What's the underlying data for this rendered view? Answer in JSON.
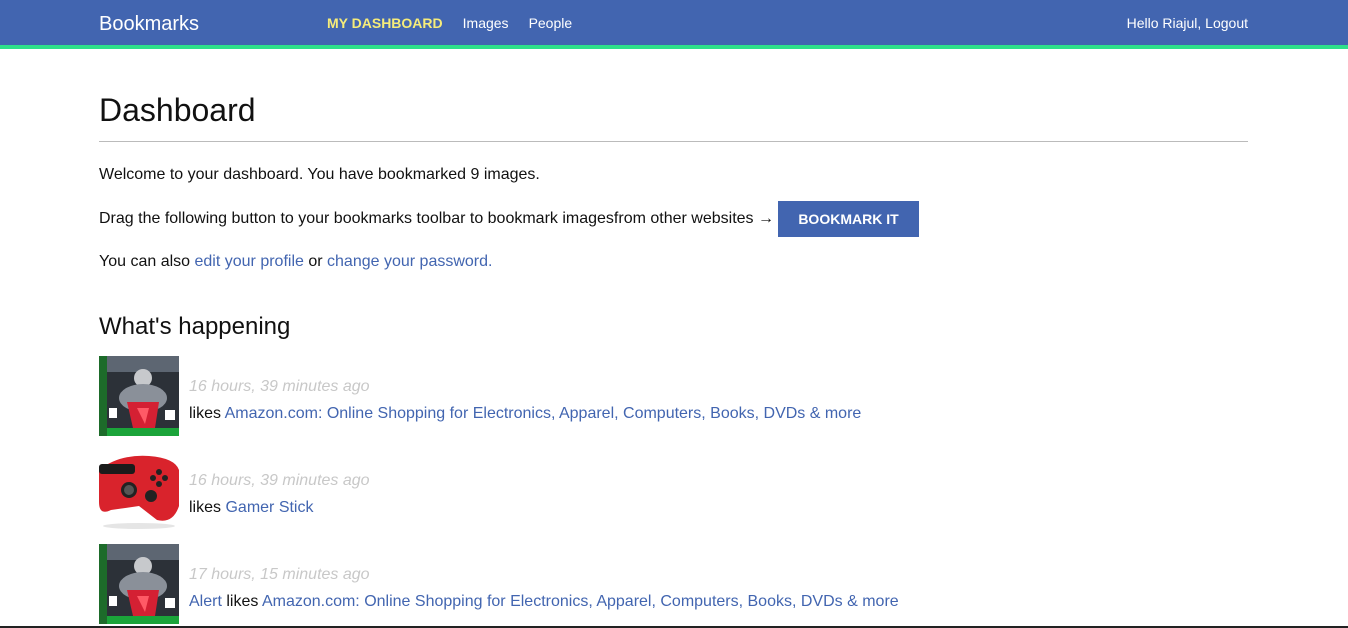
{
  "nav": {
    "logo": "Bookmarks",
    "items": [
      {
        "label": "MY DASHBOARD",
        "active": true
      },
      {
        "label": "Images",
        "active": false
      },
      {
        "label": "People",
        "active": false
      }
    ],
    "greeting": "Hello Riajul,",
    "logout_label": "Logout"
  },
  "main": {
    "title": "Dashboard",
    "welcome_text": "Welcome to your dashboard. You have bookmarked 9 images.",
    "drag_text": "Drag the following button to your bookmarks toolbar to bookmark imagesfrom other websites →",
    "bookmark_button_label": "BOOKMARK IT",
    "also_prefix": "You can also",
    "edit_profile_label": "edit your profile",
    "also_or": "or",
    "change_password_label": "change your password."
  },
  "activity": {
    "title": "What's happening",
    "items": [
      {
        "time": "16 hours, 39 minutes ago",
        "actor": "",
        "verb": "likes",
        "target": "Amazon.com: Online Shopping for Electronics, Apparel, Computers, Books, DVDs & more",
        "thumbnail": "game-box"
      },
      {
        "time": "16 hours, 39 minutes ago",
        "actor": "",
        "verb": "likes",
        "target": "Gamer Stick",
        "thumbnail": "red-controller"
      },
      {
        "time": "17 hours, 15 minutes ago",
        "actor": "Alert",
        "verb": "likes",
        "target": "Amazon.com: Online Shopping for Electronics, Apparel, Computers, Books, DVDs & more",
        "thumbnail": "game-box"
      }
    ]
  },
  "colors": {
    "brand": "#4265b0",
    "accent_border": "#2ee08a",
    "active_nav": "#f6ec7a",
    "timestamp": "#c8c8c8"
  }
}
